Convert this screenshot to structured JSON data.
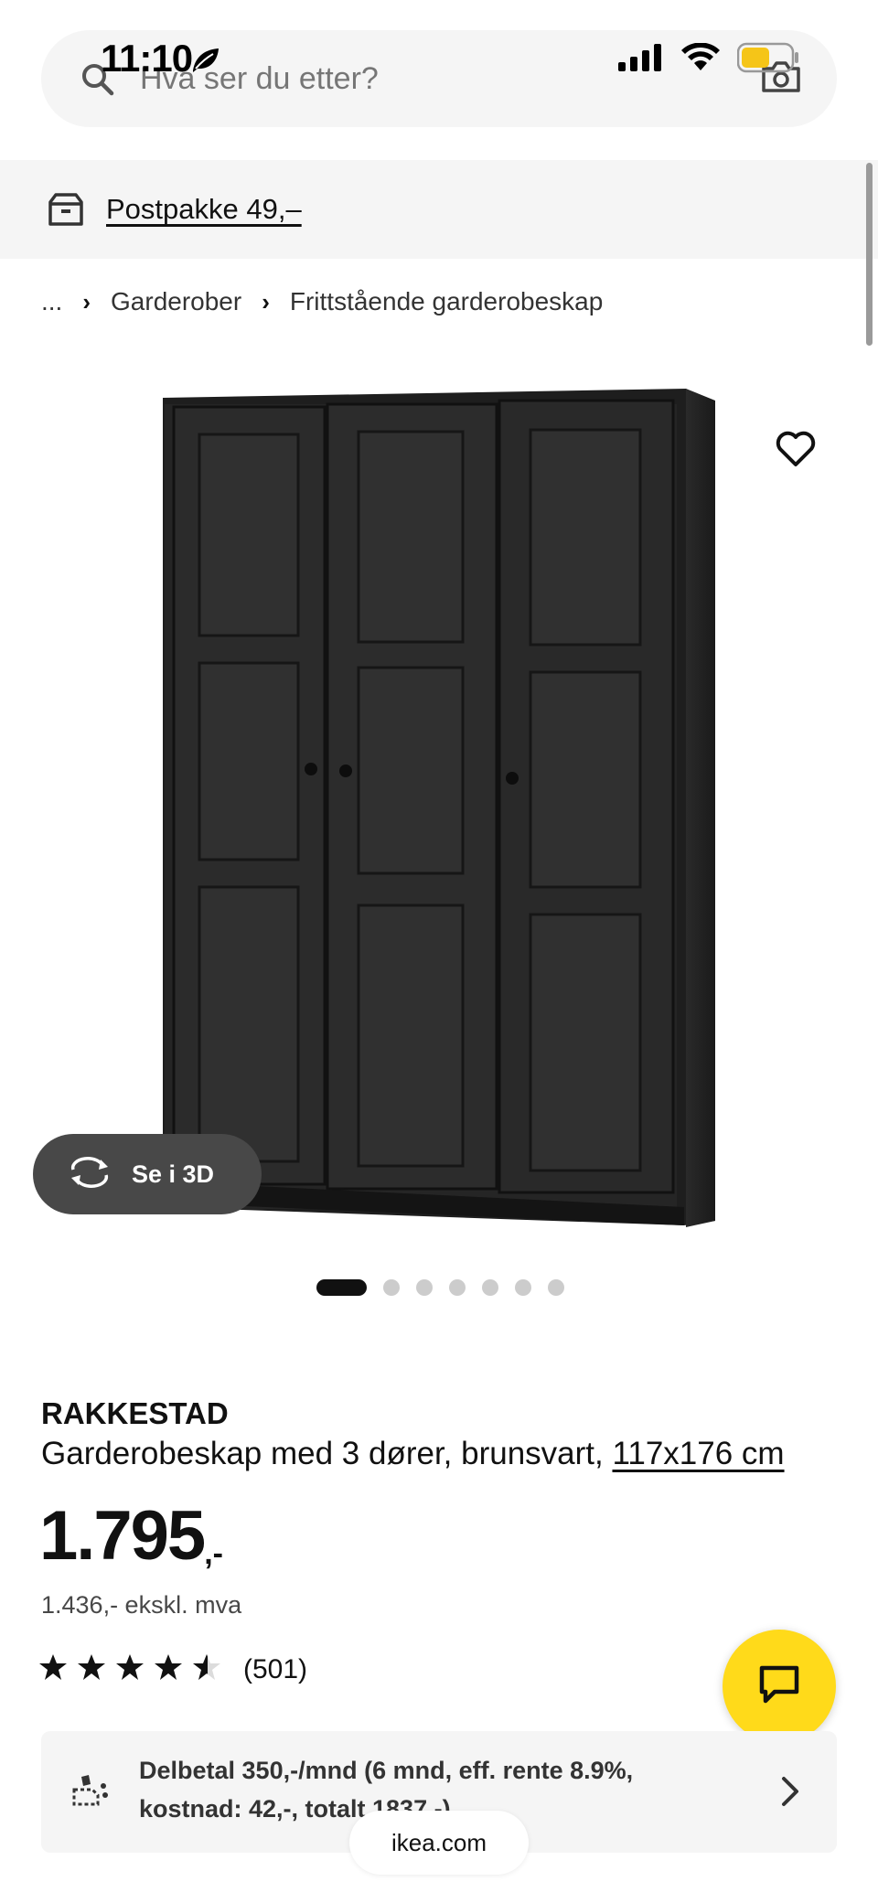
{
  "status_bar": {
    "time": "11:10",
    "icons": [
      "leaf-icon",
      "signal-icon",
      "wifi-icon",
      "battery-icon"
    ]
  },
  "search": {
    "placeholder": "Hva ser du etter?",
    "icon": "search-icon",
    "camera_icon": "camera-icon"
  },
  "shipping": {
    "label": "Postpakke 49,–",
    "icon": "box-icon"
  },
  "breadcrumb": {
    "items": [
      "...",
      "Garderober",
      "Frittstående garderobeskap"
    ]
  },
  "gallery": {
    "view3d_label": "Se i 3D",
    "dot_count": 7,
    "active_dot": 1
  },
  "product": {
    "name": "RAKKESTAD",
    "description": "Garderobeskap med 3 dører, brunsvart,",
    "size": "117x176 cm",
    "price_main": "1.795",
    "price_suffix": ",-",
    "price_ex_vat": "1.436,- ekskl. mva",
    "rating": 4.5,
    "rating_max": 5,
    "review_count": "(501)"
  },
  "installment": {
    "line1": "Delbetal 350,-/mnd (6 mnd, eff. rente 8.9%,",
    "line2": "kostnad: 42,-, totalt 1837,-)"
  },
  "browser": {
    "url": "ikea.com"
  },
  "colors": {
    "chat_button": "#ffda1a",
    "banner_bg": "#f5f5f5",
    "view3d_bg": "#484848",
    "text": "#111111"
  }
}
